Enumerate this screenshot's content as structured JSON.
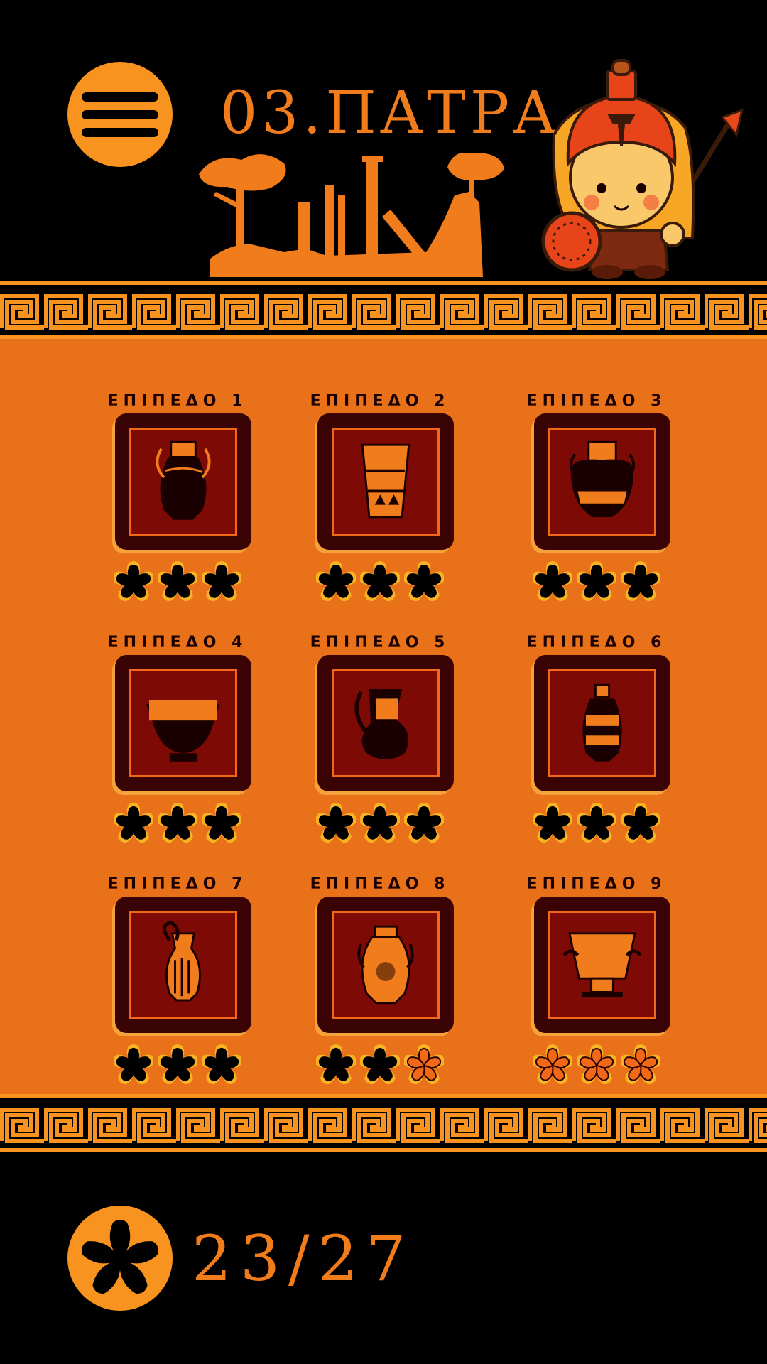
{
  "header": {
    "title": "03.ΠΑΤΡΑ"
  },
  "levels": [
    {
      "label": "ΕΠΙΠΕΔΟ 1",
      "stars": 3,
      "vase": "amphora-vase"
    },
    {
      "label": "ΕΠΙΠΕΔΟ 2",
      "stars": 3,
      "vase": "beaker-vase"
    },
    {
      "label": "ΕΠΙΠΕΔΟ 3",
      "stars": 3,
      "vase": "neck-amphora-vase"
    },
    {
      "label": "ΕΠΙΠΕΔΟ 4",
      "stars": 3,
      "vase": "dinos-vase"
    },
    {
      "label": "ΕΠΙΠΕΔΟ 5",
      "stars": 3,
      "vase": "oinochoe-vase"
    },
    {
      "label": "ΕΠΙΠΕΔΟ 6",
      "stars": 3,
      "vase": "lekythos-vase"
    },
    {
      "label": "ΕΠΙΠΕΔΟ 7",
      "stars": 3,
      "vase": "jug-vase"
    },
    {
      "label": "ΕΠΙΠΕΔΟ 8",
      "stars": 2,
      "vase": "hydria-vase"
    },
    {
      "label": "ΕΠΙΠΕΔΟ 9",
      "stars": 0,
      "vase": "krater-vase"
    }
  ],
  "score": {
    "text": "23/27"
  },
  "colors": {
    "accent": "#f7931e",
    "background": "#e9711a",
    "tile": "#3a0404",
    "tile_inner": "#7e0a06",
    "text_dark": "#1a0000"
  }
}
